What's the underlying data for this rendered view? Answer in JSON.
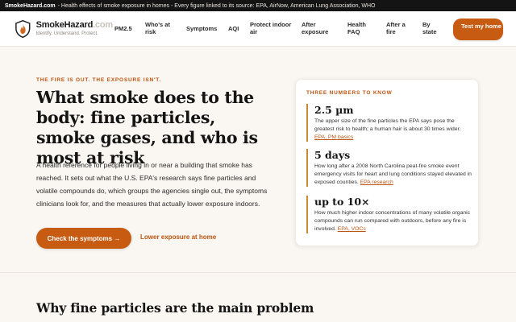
{
  "topbar": {
    "site": "SmokeHazard.com",
    "text": "- Health effects of smoke exposure in homes - Every figure linked to its source: EPA, AirNow, American Lung Association, WHO"
  },
  "brand": {
    "name": "SmokeHazard",
    "tld": ".com",
    "tagline": "Identify. Understand. Protect.",
    "logo_icon": "shield-flame-icon"
  },
  "nav": {
    "items": [
      "PM2.5",
      "Who's at risk",
      "Symptoms",
      "AQI",
      "Protect indoor air",
      "After exposure",
      "Health FAQ",
      "After a fire",
      "By state"
    ],
    "cta": "Test my home"
  },
  "hero": {
    "eyebrow": "THE FIRE IS OUT. THE EXPOSURE ISN'T.",
    "headline": "What smoke does to the body: fine particles, smoke gases, and who is most at risk",
    "intro": "A health reference for people living in or near a building that smoke has reached. It sets out what the U.S. EPA's research says fine particles and volatile compounds do, which groups the agencies single out, the symptoms clinicians look for, and the measures that actually lower exposure indoors.",
    "primary_button": "Check the symptoms →",
    "secondary_link": "Lower exposure at home"
  },
  "card": {
    "title": "THREE NUMBERS TO KNOW",
    "stats": [
      {
        "value": "2.5 µm",
        "desc": "The upper size of the fine particles the EPA says pose the greatest risk to health; a human hair is about 30 times wider.",
        "source": "EPA, PM basics"
      },
      {
        "value": "5 days",
        "desc": "How long after a 2008 North Carolina peat-fire smoke event emergency visits for heart and lung conditions stayed elevated in exposed counties.",
        "source": "EPA research"
      },
      {
        "value": "up to 10×",
        "desc": "How much higher indoor concentrations of many volatile organic compounds can run compared with outdoors, before any fire is involved.",
        "source": "EPA, VOCs"
      }
    ]
  },
  "section": {
    "title": "Why fine particles are the main problem"
  },
  "colors": {
    "accent": "#c75b12",
    "dark": "#141414",
    "background": "#faf6f1"
  }
}
